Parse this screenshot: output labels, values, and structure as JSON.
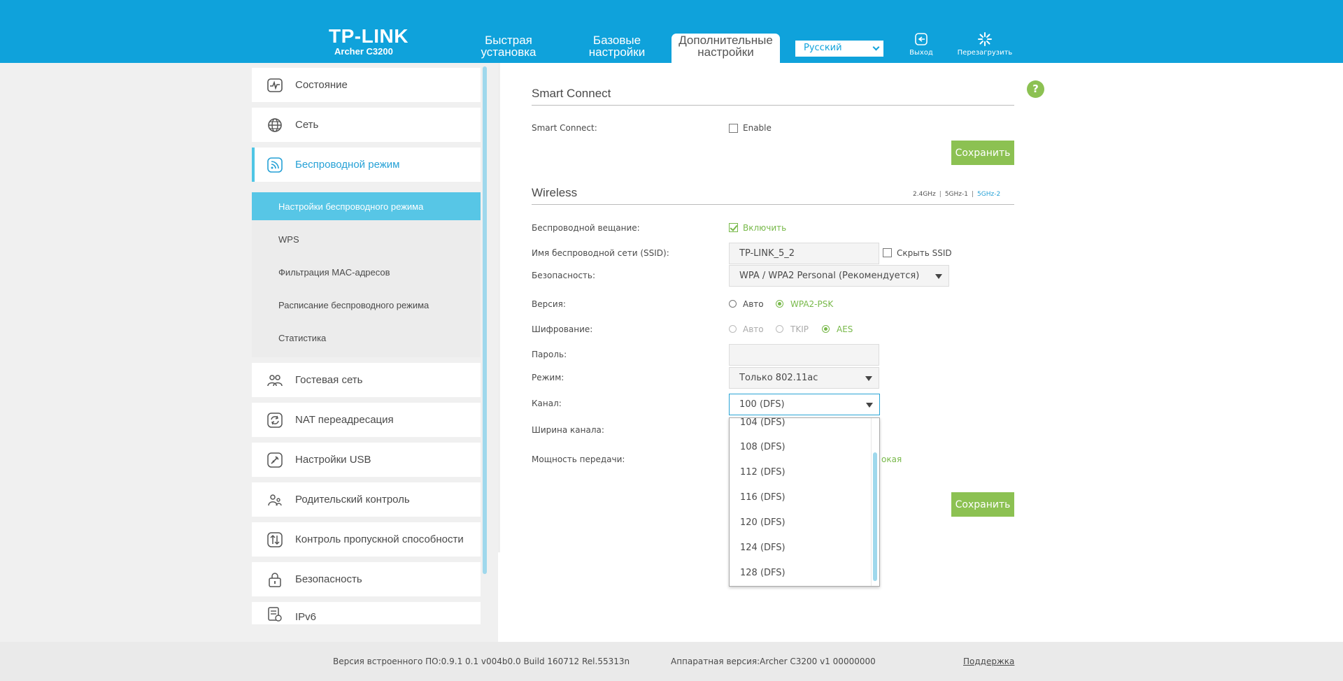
{
  "header": {
    "brand": "TP-LINK",
    "model": "Archer C3200",
    "tabs": [
      {
        "line1": "Быстрая",
        "line2": "установка"
      },
      {
        "line1": "Базовые",
        "line2": "настройки"
      },
      {
        "line1": "Дополнительные",
        "line2": "настройки"
      }
    ],
    "language": "Русский",
    "logout_label": "Выход",
    "reboot_label": "Перезагрузить",
    "colors": {
      "primary": "#0fa2db",
      "accent_green": "#8cc152"
    }
  },
  "sidebar": {
    "items": [
      {
        "label": "Состояние",
        "icon": "status-icon"
      },
      {
        "label": "Сеть",
        "icon": "globe-icon"
      },
      {
        "label": "Беспроводной режим",
        "icon": "wifi-icon"
      },
      {
        "label": "Гостевая сеть",
        "icon": "guest-network-icon"
      },
      {
        "label": "NAT переадресация",
        "icon": "nat-icon"
      },
      {
        "label": "Настройки USB",
        "icon": "usb-icon"
      },
      {
        "label": "Родительский контроль",
        "icon": "parental-control-icon"
      },
      {
        "label": "Контроль пропускной способности",
        "icon": "bandwidth-icon"
      },
      {
        "label": "Безопасность",
        "icon": "lock-icon"
      },
      {
        "label": "IPv6",
        "icon": "ipv6-icon"
      }
    ],
    "subitems": [
      "Настройки беспроводного режима",
      "WPS",
      "Фильтрация MAC-адресов",
      "Расписание беспроводного режима",
      "Статистика"
    ]
  },
  "smart_connect": {
    "title": "Smart Connect",
    "label": "Smart Connect:",
    "enable_label": "Enable",
    "save_label": "Сохранить"
  },
  "wireless": {
    "title": "Wireless",
    "bands": [
      "2.4GHz",
      "5GHz-1",
      "5GHz-2"
    ],
    "selected_band": "5GHz-2",
    "broadcast_label": "Беспроводной вещание:",
    "broadcast_value": "Включить",
    "ssid_label": "Имя беспроводной сети (SSID):",
    "ssid_value": "TP-LINK_5_2",
    "hide_ssid_label": "Скрыть SSID",
    "security_label": "Безопасность:",
    "security_value": "WPA / WPA2 Personal (Рекомендуется)",
    "version_label": "Версия:",
    "version_options": [
      "Авто",
      "WPA2-PSK"
    ],
    "encryption_label": "Шифрование:",
    "encryption_options": [
      "Авто",
      "TKIP",
      "AES"
    ],
    "password_label": "Пароль:",
    "mode_label": "Режим:",
    "mode_value": "Только 802.11ac",
    "channel_label": "Канал:",
    "channel_value": "100 (DFS)",
    "width_label": "Ширина канала:",
    "power_label": "Мощность передачи:",
    "power_visible_fragment": "окая",
    "save_label": "Сохранить",
    "channel_options": [
      "104 (DFS)",
      "108 (DFS)",
      "112 (DFS)",
      "116 (DFS)",
      "120 (DFS)",
      "124 (DFS)",
      "128 (DFS)"
    ]
  },
  "footer": {
    "firmware": "Версия встроенного ПО:0.9.1 0.1 v004b0.0 Build 160712 Rel.55313n",
    "hardware": "Аппаратная версия:Archer C3200 v1 00000000",
    "support": "Поддержка"
  }
}
